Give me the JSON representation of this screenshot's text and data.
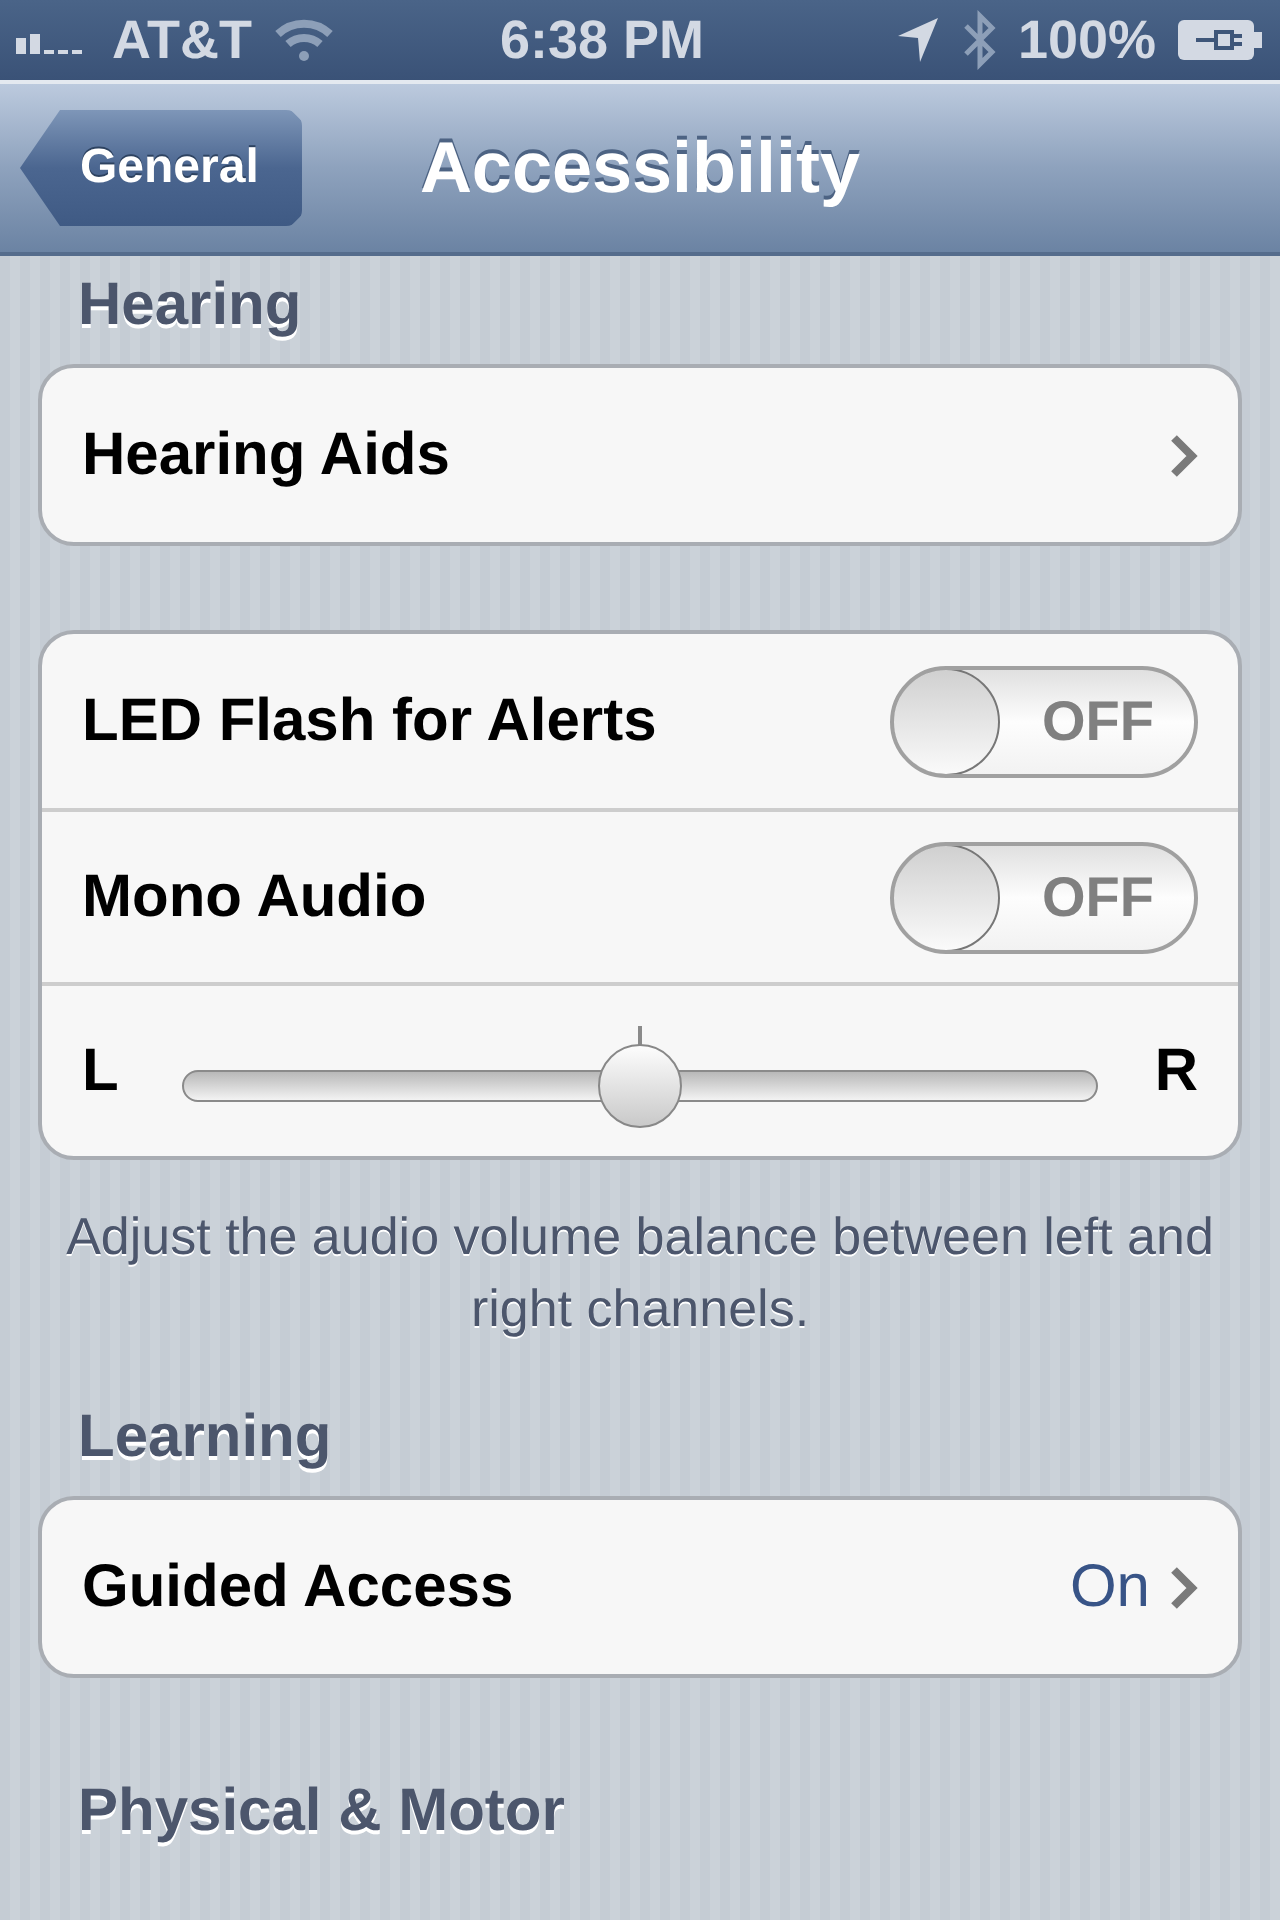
{
  "status_bar": {
    "carrier": "AT&T",
    "time": "6:38 PM",
    "battery": "100%"
  },
  "nav_bar": {
    "back": "General",
    "title": "Accessibility"
  },
  "blocks": [
    {
      "kind": "header",
      "text": "Hearing"
    },
    {
      "kind": "group",
      "rows": [
        {
          "kind": "link",
          "label": "Hearing Aids"
        }
      ]
    },
    {
      "kind": "group",
      "rows": [
        {
          "kind": "toggle",
          "label": "LED Flash for Alerts",
          "on": false,
          "state_text": "OFF"
        },
        {
          "kind": "toggle",
          "label": "Mono Audio",
          "on": false,
          "state_text": "OFF"
        },
        {
          "kind": "slider",
          "left": "L",
          "right": "R",
          "level": 0.5
        }
      ]
    },
    {
      "kind": "footer",
      "text": "Adjust the audio volume balance between left and right channels."
    },
    {
      "kind": "header",
      "text": "Learning"
    },
    {
      "kind": "group",
      "rows": [
        {
          "kind": "link",
          "label": "Guided Access",
          "value": "On"
        }
      ]
    },
    {
      "kind": "header",
      "text": "Physical & Motor"
    }
  ]
}
